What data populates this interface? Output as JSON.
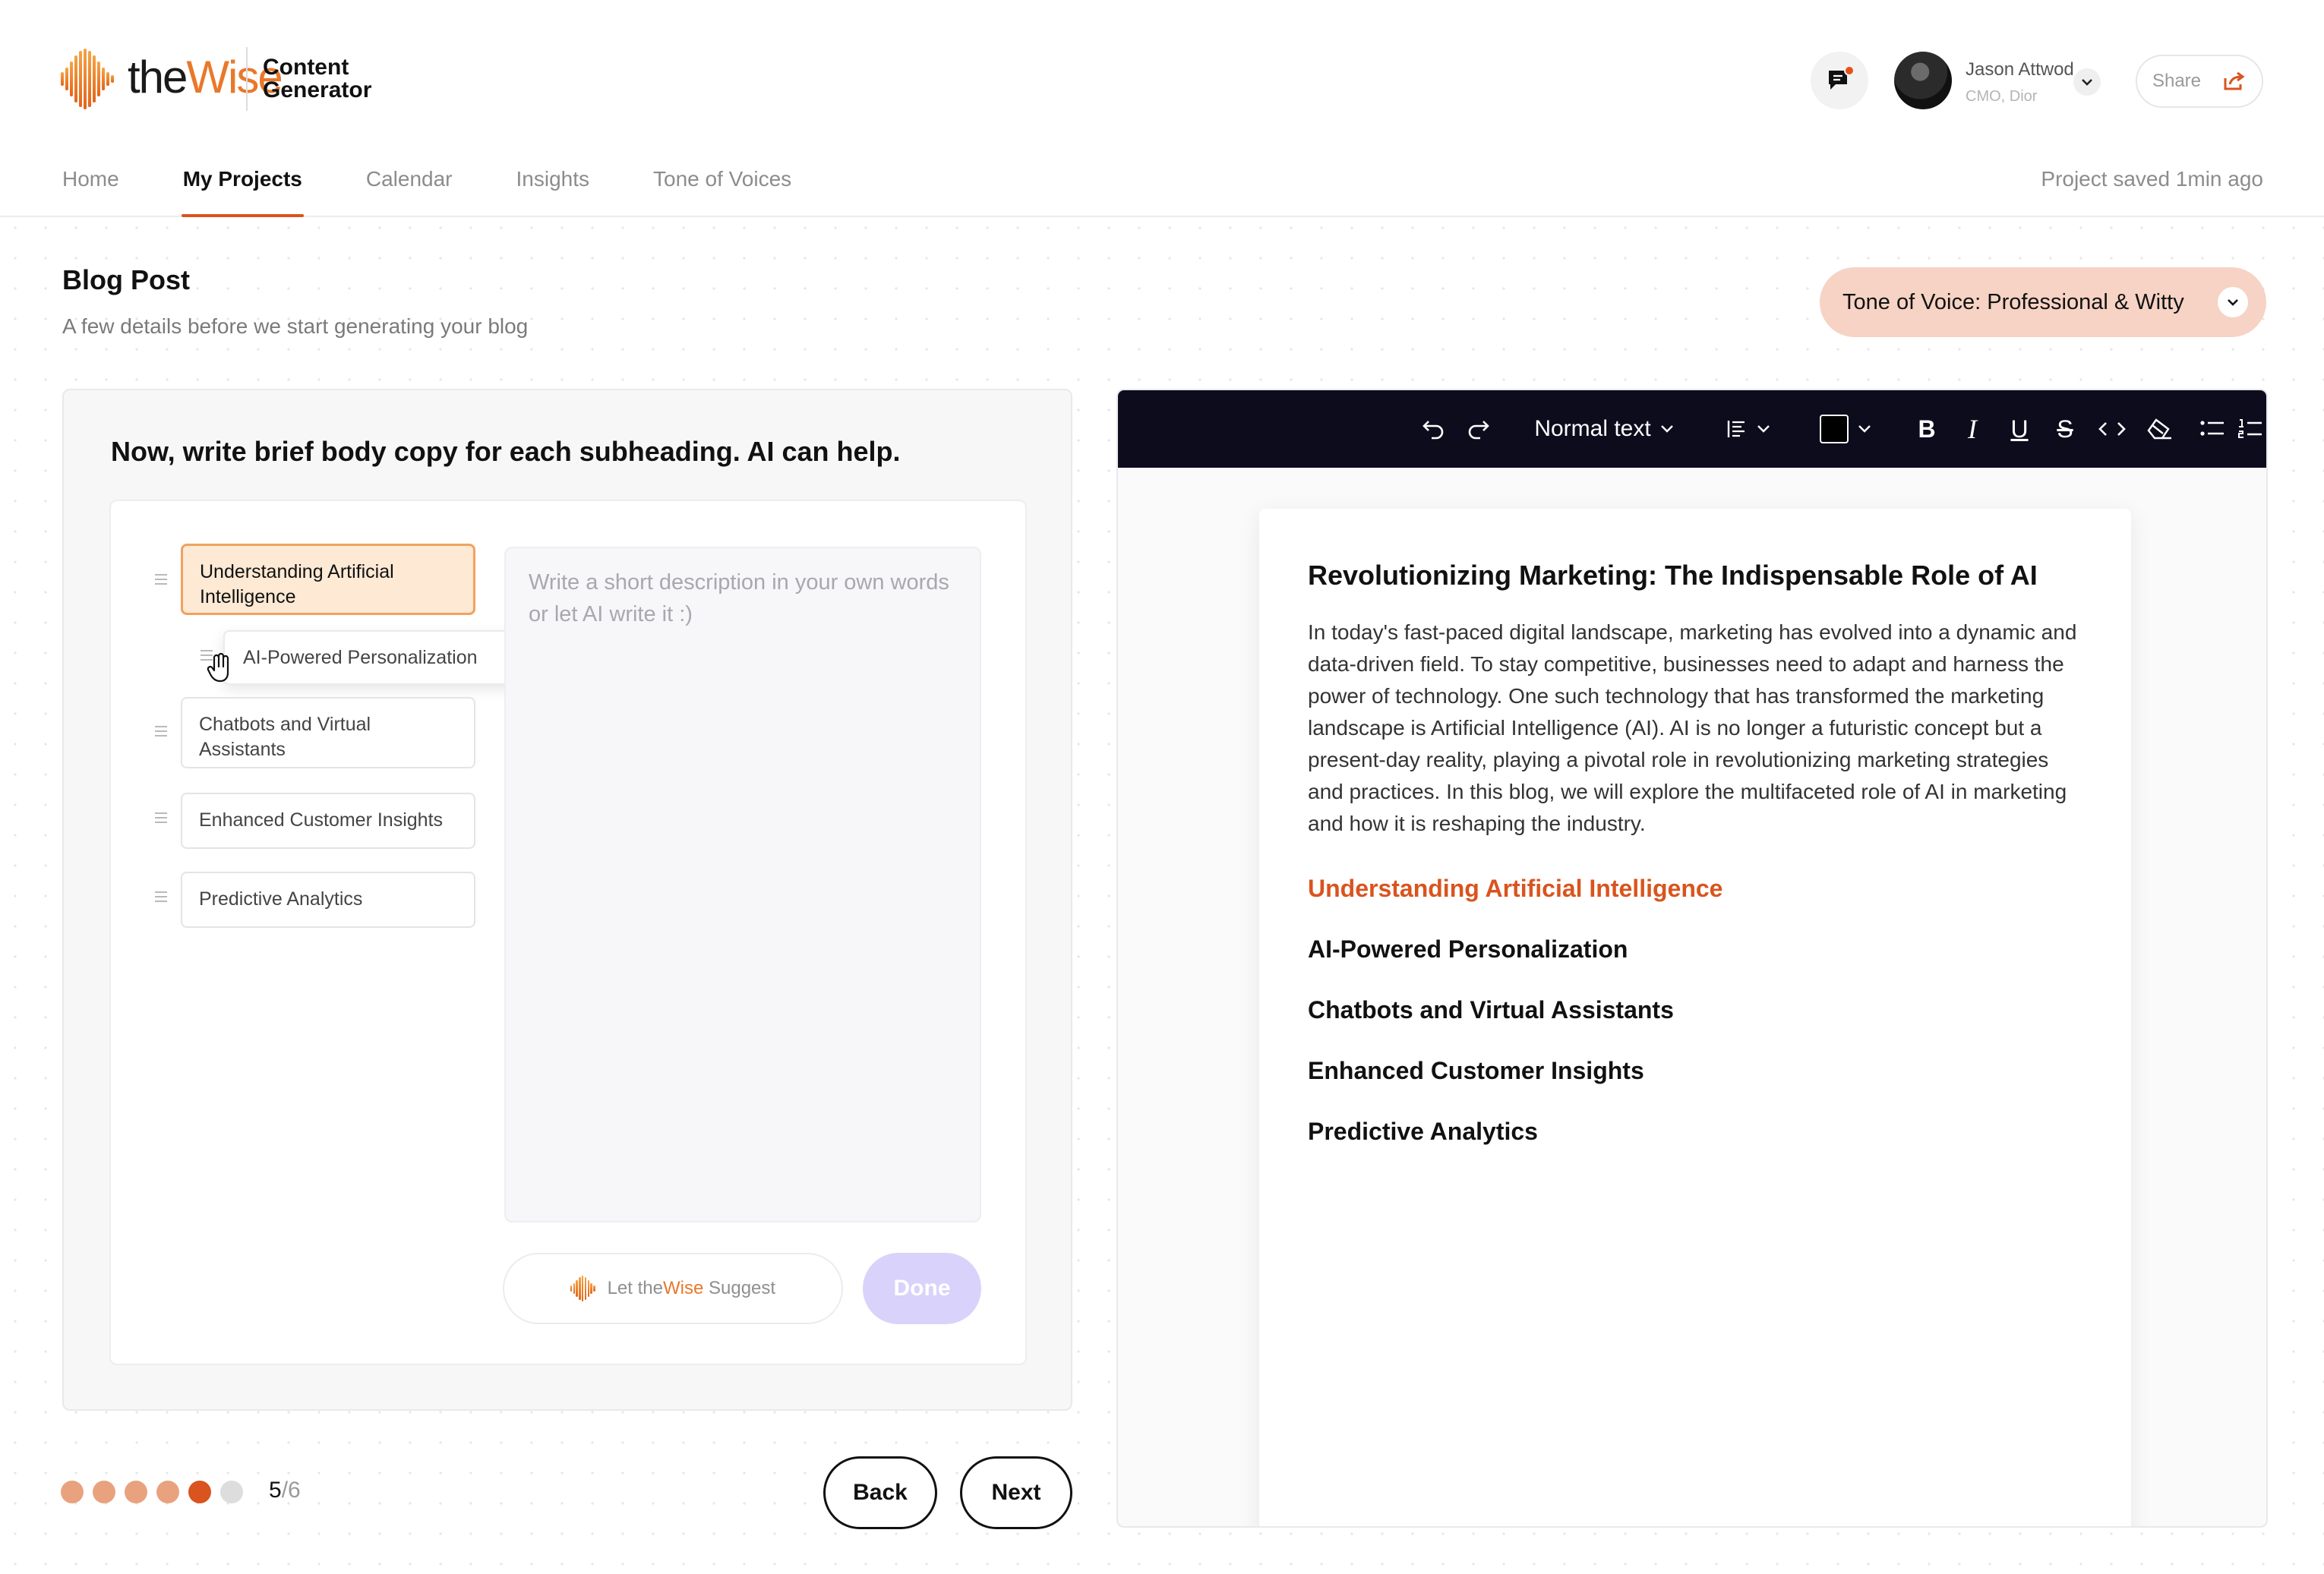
{
  "brand": {
    "logo_the": "the",
    "logo_wise": "Wise",
    "product_line1": "Content",
    "product_line2": "Generator",
    "accent_color": "#d9541e"
  },
  "user": {
    "name": "Jason Attwod",
    "role": "CMO, Dior",
    "share_label": "Share"
  },
  "nav": {
    "items": [
      {
        "label": "Home",
        "active": false
      },
      {
        "label": "My Projects",
        "active": true
      },
      {
        "label": "Calendar",
        "active": false
      },
      {
        "label": "Insights",
        "active": false
      },
      {
        "label": "Tone of Voices",
        "active": false
      }
    ],
    "saved_status": "Project saved 1min ago"
  },
  "page": {
    "title": "Blog Post",
    "subtitle": "A few details before we start generating your blog",
    "tone_label": "Tone of Voice: Professional & Witty"
  },
  "editor_left": {
    "heading": "Now, write brief body copy for each subheading. AI can help.",
    "subheadings": [
      {
        "label": "Understanding Artificial Intelligence",
        "active": true
      },
      {
        "label": "AI-Powered Personalization",
        "dragging": true
      },
      {
        "label": "Chatbots and Virtual Assistants",
        "active": false
      },
      {
        "label": "Enhanced Customer Insights",
        "active": false
      },
      {
        "label": "Predictive Analytics",
        "active": false
      }
    ],
    "description_placeholder": "Write a short description in your own words or let AI write it :)",
    "suggest_prefix": "Let the",
    "suggest_brand": "Wise",
    "suggest_suffix": "Suggest",
    "done_label": "Done"
  },
  "steps": {
    "current": "5",
    "total": "/6",
    "colors": [
      "#e9a27e",
      "#e9a27e",
      "#e9a27e",
      "#e9a27e",
      "#d9541e",
      "#dddddd"
    ]
  },
  "footer": {
    "back_label": "Back",
    "next_label": "Next"
  },
  "toolbar": {
    "text_style": "Normal text",
    "bold": "B",
    "italic": "I",
    "underline": "U",
    "strike": "S"
  },
  "document": {
    "title": "Revolutionizing Marketing: The Indispensable Role of AI",
    "intro": "In today's fast-paced digital landscape, marketing has evolved into a dynamic and data-driven field. To stay competitive, businesses need to adapt and harness the power of technology. One such technology that has transformed the marketing landscape is Artificial Intelligence (AI). AI is no longer a futuristic concept but a present-day reality, playing a pivotal role in revolutionizing marketing strategies and practices. In this blog, we will explore the multifaceted role of AI in marketing and how it is reshaping the industry.",
    "headings": [
      "Understanding Artificial Intelligence",
      "AI-Powered Personalization",
      "Chatbots and Virtual Assistants",
      "Enhanced Customer Insights",
      "Predictive Analytics"
    ]
  }
}
